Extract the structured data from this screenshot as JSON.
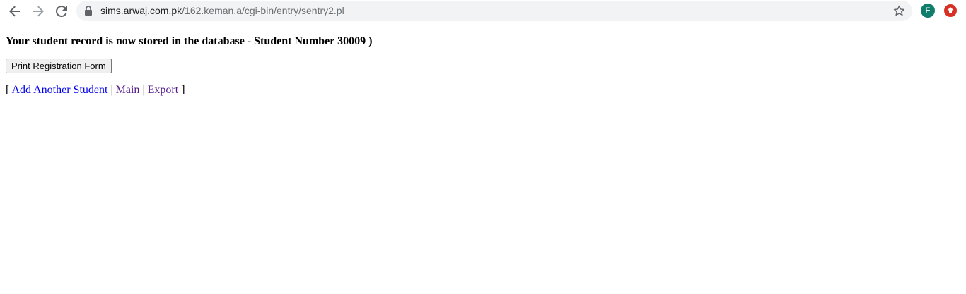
{
  "browser": {
    "url_host": "sims.arwaj.com.pk",
    "url_path": "/162.keman.a/cgi-bin/entry/sentry2.pl",
    "profile_initial": "F",
    "icons": [
      "back-arrow-icon",
      "forward-arrow-icon",
      "reload-icon",
      "lock-icon",
      "bookmark-star-icon",
      "profile-avatar",
      "extension-icon"
    ],
    "colors": {
      "avatar": "#0f7d6c",
      "extension": "#d93025"
    }
  },
  "page": {
    "message": "Your student record is now stored in the database - Student Number 30009 )",
    "print_button": "Print Registration Form",
    "bracket_open": "[",
    "bracket_close": "]",
    "separator": "|",
    "links": {
      "add_student": "Add Another Student",
      "main": "Main",
      "export": "Export"
    }
  }
}
